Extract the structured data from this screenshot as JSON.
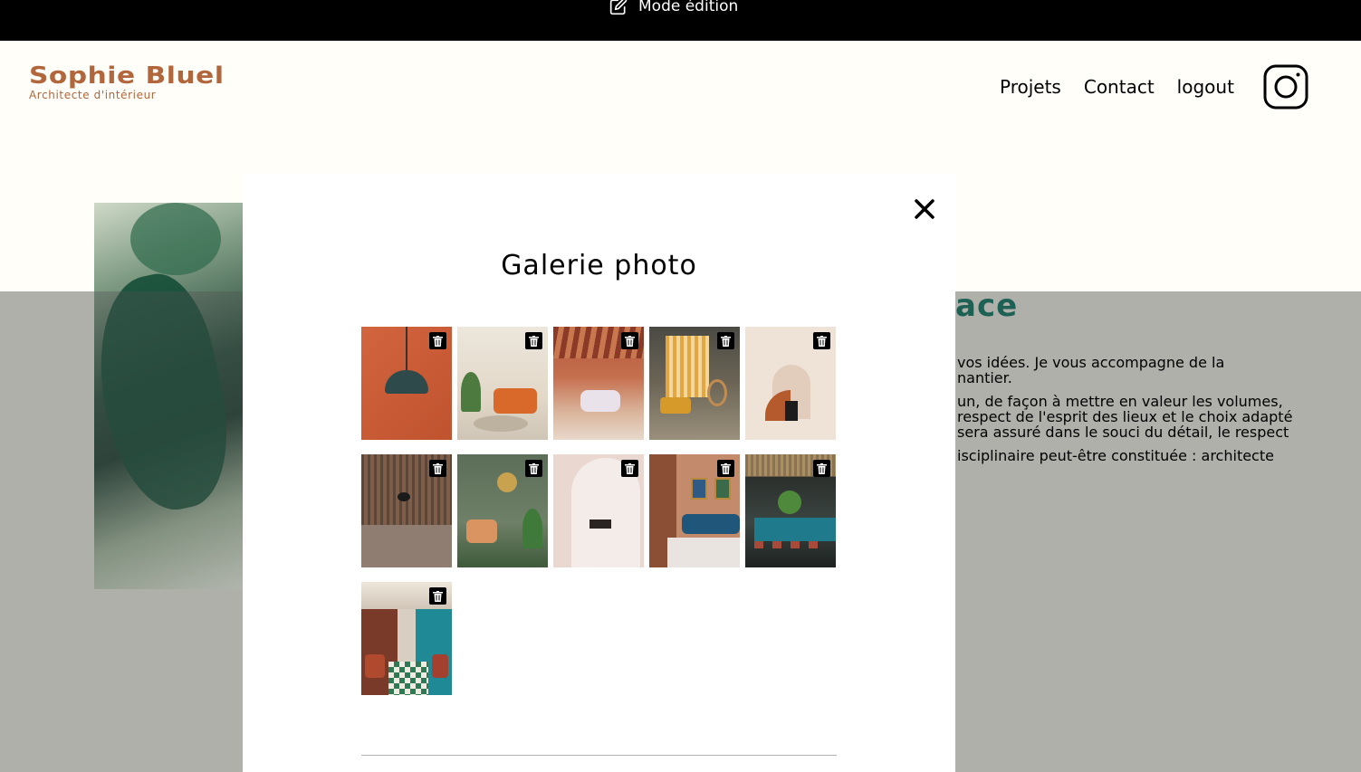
{
  "edit_bar": {
    "label": "Mode édition"
  },
  "header": {
    "logo_name": "Sophie Bluel",
    "logo_subtitle": "Architecte d'intérieur",
    "nav": [
      "Projets",
      "Contact",
      "logout"
    ]
  },
  "intro": {
    "title": "ace",
    "paragraphs": [
      "vos idées. Je vous accompagne de la\nnantier.",
      "un, de façon à mettre en valeur les volumes,\nrespect de l'esprit des lieux et le choix adapté\nsera assuré dans le souci du détail, le respect",
      "isciplinaire peut-être constituée : architecte"
    ]
  },
  "modal": {
    "title": "Galerie photo",
    "thumbnails": [
      "lamp",
      "living-room-orange-sofa",
      "restaurant-hall",
      "reception-yellow",
      "arches",
      "kitchen-wood",
      "green-living-room",
      "white-arch-room",
      "blue-sofa-lounge",
      "teal-bar",
      "long-dining-hall"
    ]
  },
  "colors": {
    "brand": "#B1663C",
    "accent": "#1D6154",
    "edit_bar": "#000000"
  }
}
